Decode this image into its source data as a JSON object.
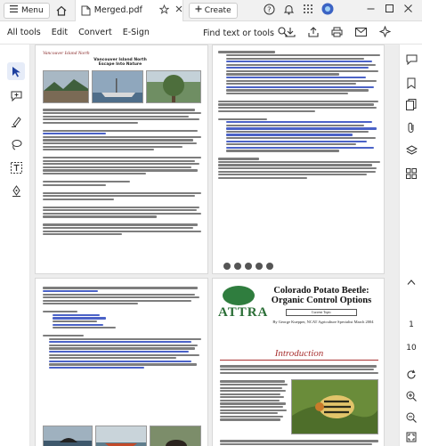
{
  "titlebar": {
    "menu_label": "Menu",
    "tab_title": "Merged.pdf",
    "create_label": "Create"
  },
  "toolbar": {
    "menus": [
      "All tools",
      "Edit",
      "Convert",
      "E-Sign"
    ],
    "find_label": "Find text or tools"
  },
  "pages": {
    "p1": {
      "logo_text": "Vancouver Island North",
      "heading1": "Vancouver Island North",
      "heading2": "Escape Into Nature"
    },
    "p4": {
      "logo_text": "ATTRA",
      "title": "Colorado Potato Beetle: Organic Control Options",
      "subtitle": "Current Topic",
      "byline": "By George Kuepper, NCAT Agriculture Specialist March 2004",
      "section": "Introduction"
    }
  },
  "right_rail": {
    "page_number": "1",
    "page_total": "10"
  },
  "colors": {
    "accent": "#3b63c4",
    "link": "#4b62c7",
    "attra_green": "#2a6e36",
    "intro_red": "#aa3333"
  }
}
